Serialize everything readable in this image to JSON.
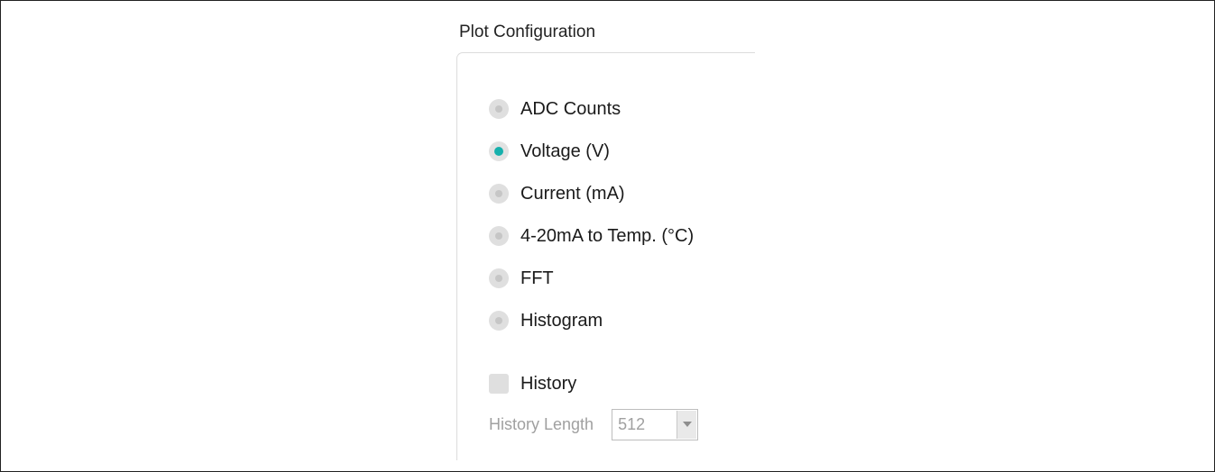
{
  "group": {
    "title": "Plot Configuration"
  },
  "plot_modes": [
    {
      "label": "ADC Counts",
      "selected": false
    },
    {
      "label": "Voltage (V)",
      "selected": true
    },
    {
      "label": "Current (mA)",
      "selected": false
    },
    {
      "label": "4-20mA to Temp. (°C)",
      "selected": false
    },
    {
      "label": "FFT",
      "selected": false
    },
    {
      "label": "Histogram",
      "selected": false
    }
  ],
  "history": {
    "label": "History",
    "checked": false,
    "length_label": "History Length",
    "length_value": "512",
    "length_enabled": false
  },
  "colors": {
    "accent": "#16b0ac",
    "disabled_text": "#a0a0a0",
    "control_bg": "#dfdfdf"
  }
}
